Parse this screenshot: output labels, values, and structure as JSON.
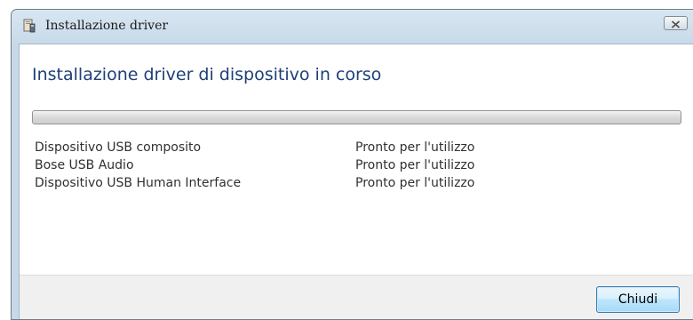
{
  "window": {
    "title": "Installazione driver",
    "close_glyph": "✕"
  },
  "main": {
    "heading": "Installazione driver di dispositivo in corso",
    "progress_percent": 0,
    "devices": [
      {
        "name": "Dispositivo USB composito",
        "status": "Pronto per l'utilizzo"
      },
      {
        "name": "Bose USB Audio",
        "status": "Pronto per l'utilizzo"
      },
      {
        "name": "Dispositivo USB Human Interface",
        "status": "Pronto per l'utilizzo"
      }
    ]
  },
  "footer": {
    "close_button_label": "Chiudi"
  },
  "icons": {
    "title": "driver-install-icon",
    "close": "close-icon"
  },
  "colors": {
    "heading": "#1e3f78",
    "frame": "#c7d9e8",
    "button_border": "#3c7fb1"
  }
}
